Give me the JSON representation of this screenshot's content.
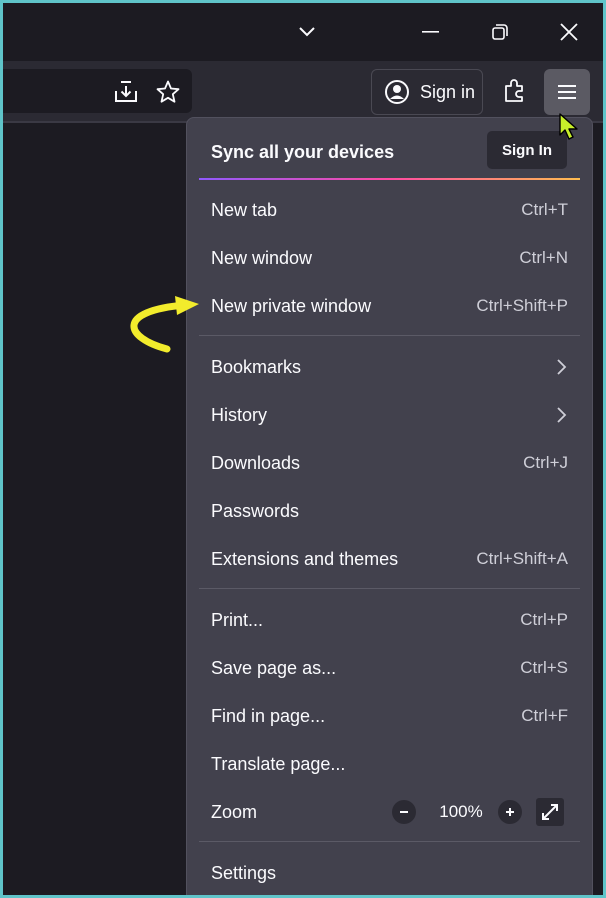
{
  "titlebar": {
    "tabs_dropdown_icon": "chevron-down-icon",
    "minimize_icon": "minimize-icon",
    "restore_icon": "restore-icon",
    "close_icon": "close-icon"
  },
  "toolbar": {
    "signin_label": "Sign in",
    "icons": [
      "download-icon",
      "star-icon",
      "account-icon",
      "extensions-icon",
      "hamburger-menu-icon"
    ]
  },
  "menu": {
    "sync": {
      "title": "Sync all your devices",
      "button": "Sign In"
    },
    "items": [
      {
        "label": "New tab",
        "shortcut": "Ctrl+T"
      },
      {
        "label": "New window",
        "shortcut": "Ctrl+N"
      },
      {
        "label": "New private window",
        "shortcut": "Ctrl+Shift+P"
      },
      {
        "label": "Bookmarks",
        "submenu": true
      },
      {
        "label": "History",
        "submenu": true
      },
      {
        "label": "Downloads",
        "shortcut": "Ctrl+J"
      },
      {
        "label": "Passwords"
      },
      {
        "label": "Extensions and themes",
        "shortcut": "Ctrl+Shift+A"
      },
      {
        "label": "Print...",
        "shortcut": "Ctrl+P"
      },
      {
        "label": "Save page as...",
        "shortcut": "Ctrl+S"
      },
      {
        "label": "Find in page...",
        "shortcut": "Ctrl+F"
      },
      {
        "label": "Translate page..."
      },
      {
        "label": "Zoom",
        "zoom_value": "100%"
      },
      {
        "label": "Settings"
      }
    ]
  },
  "colors": {
    "highlight_arrow": "#f2ec2c",
    "cursor": "#c8f02a",
    "panel_bg": "#42414d",
    "frame_border": "#5fc4c9"
  }
}
